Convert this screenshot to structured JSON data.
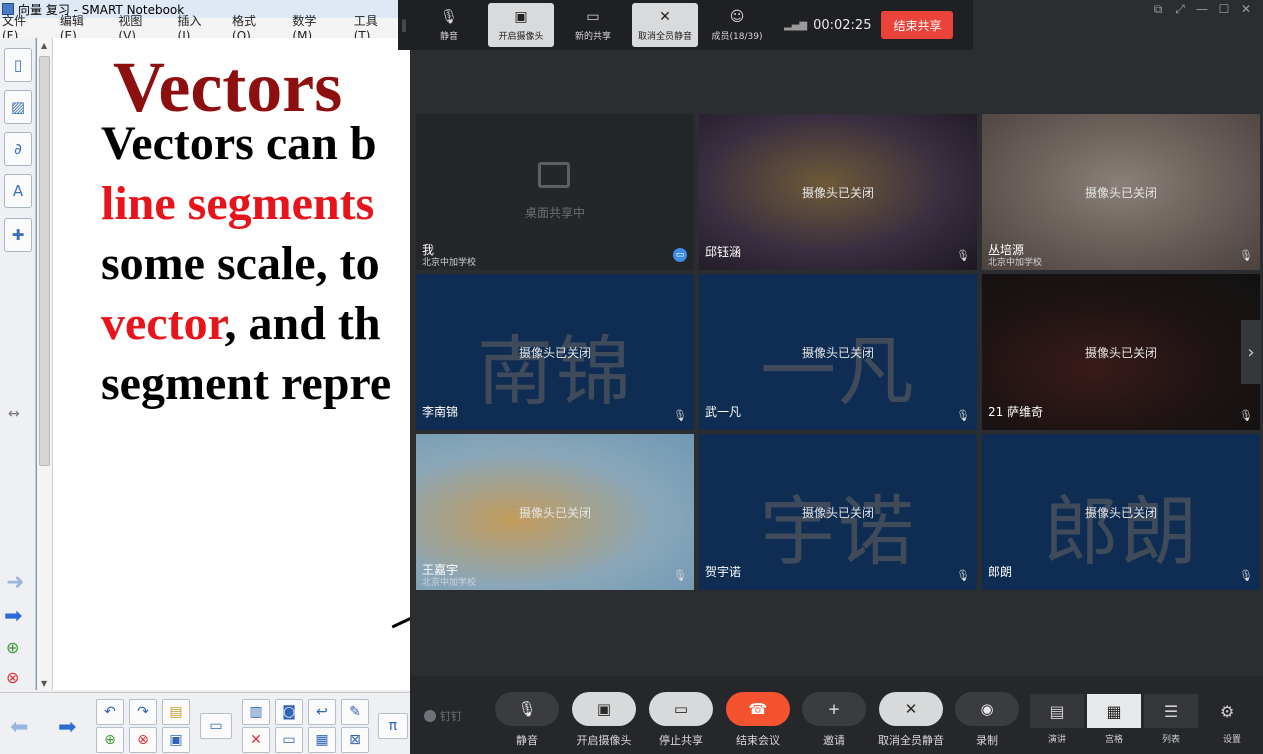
{
  "notebook": {
    "title": "向量 复习 - SMART Notebook",
    "menu": [
      "文件 (F)",
      "编辑 (E)",
      "视图 (V)",
      "插入 (I)",
      "格式 (O)",
      "数学 (M)",
      "工具 (T)"
    ],
    "slide": {
      "title": "Vectors",
      "lines": [
        {
          "parts": [
            {
              "text": "Vectors can b",
              "red": false
            }
          ]
        },
        {
          "parts": [
            {
              "text": "line segments",
              "red": true
            }
          ]
        },
        {
          "parts": [
            {
              "text": "some scale, to",
              "red": false
            }
          ]
        },
        {
          "parts": [
            {
              "text": "vector",
              "red": true
            },
            {
              "text": ", and th",
              "red": false
            }
          ]
        },
        {
          "parts": [
            {
              "text": "segment repre",
              "red": false
            }
          ]
        }
      ]
    }
  },
  "meeting": {
    "top_toolbar": {
      "items": [
        {
          "label": "静音",
          "icon": "microphone-icon",
          "glyph": "🎙",
          "active": false
        },
        {
          "label": "开启摄像头",
          "icon": "camera-off-icon",
          "glyph": "▣",
          "active": true
        },
        {
          "label": "新的共享",
          "icon": "share-screen-icon",
          "glyph": "▭",
          "active": false
        },
        {
          "label": "取消全员静音",
          "icon": "mute-all-icon",
          "glyph": "✕",
          "active": true
        },
        {
          "label": "成员(18/39)",
          "icon": "members-icon",
          "glyph": "☺",
          "active": false
        }
      ],
      "timer": "00:02:25",
      "end_share": "结束共享"
    },
    "tiles": [
      {
        "name": "我",
        "sub": "北京中加学校",
        "center": "桌面共享中",
        "bg": "dark",
        "big": "",
        "badge": "share"
      },
      {
        "name": "邱钰涵",
        "sub": "",
        "center": "摄像头已关闭",
        "bg": "photo1",
        "big": "",
        "badge": "mic"
      },
      {
        "name": "丛培源",
        "sub": "北京中加学校",
        "center": "摄像头已关闭",
        "bg": "photo2",
        "big": "",
        "badge": "mic"
      },
      {
        "name": "李南锦",
        "sub": "",
        "center": "摄像头已关闭",
        "bg": "navy",
        "big": "南锦",
        "badge": "mic"
      },
      {
        "name": "武一凡",
        "sub": "",
        "center": "摄像头已关闭",
        "bg": "navy",
        "big": "一凡",
        "badge": "mic"
      },
      {
        "name": "21 萨维奇",
        "sub": "",
        "center": "摄像头已关闭",
        "bg": "photo3",
        "big": "",
        "badge": "mic"
      },
      {
        "name": "王嘉宇",
        "sub": "北京中加学校",
        "center": "摄像头已关闭",
        "bg": "photo4",
        "big": "",
        "badge": "mic"
      },
      {
        "name": "贺宇诺",
        "sub": "",
        "center": "摄像头已关闭",
        "bg": "navy",
        "big": "宇诺",
        "badge": "mic"
      },
      {
        "name": "郎朗",
        "sub": "",
        "center": "摄像头已关闭",
        "bg": "navy",
        "big": "郎朗",
        "badge": "mic"
      }
    ],
    "bottom": {
      "brand": "钉钉",
      "buttons": [
        {
          "label": "静音",
          "icon": "microphone-icon",
          "glyph": "🎙",
          "style": "dark"
        },
        {
          "label": "开启摄像头",
          "icon": "camera-off-icon",
          "glyph": "▣",
          "style": "light"
        },
        {
          "label": "停止共享",
          "icon": "stop-share-icon",
          "glyph": "▭",
          "style": "light"
        },
        {
          "label": "结束会议",
          "icon": "hangup-icon",
          "glyph": "☎",
          "style": "red"
        },
        {
          "label": "邀请",
          "icon": "invite-icon",
          "glyph": "+",
          "style": "dark"
        },
        {
          "label": "取消全员静音",
          "icon": "mute-all-icon",
          "glyph": "✕",
          "style": "light"
        },
        {
          "label": "录制",
          "icon": "record-icon",
          "glyph": "◉",
          "style": "dark"
        }
      ],
      "views": [
        {
          "label": "演讲",
          "icon": "speaker-view-icon",
          "glyph": "▤",
          "selected": false
        },
        {
          "label": "宫格",
          "icon": "grid-view-icon",
          "glyph": "▦",
          "selected": true
        },
        {
          "label": "列表",
          "icon": "list-view-icon",
          "glyph": "☰",
          "selected": false
        }
      ],
      "settings": {
        "label": "设置",
        "icon": "settings-icon",
        "glyph": "⚙"
      }
    }
  }
}
